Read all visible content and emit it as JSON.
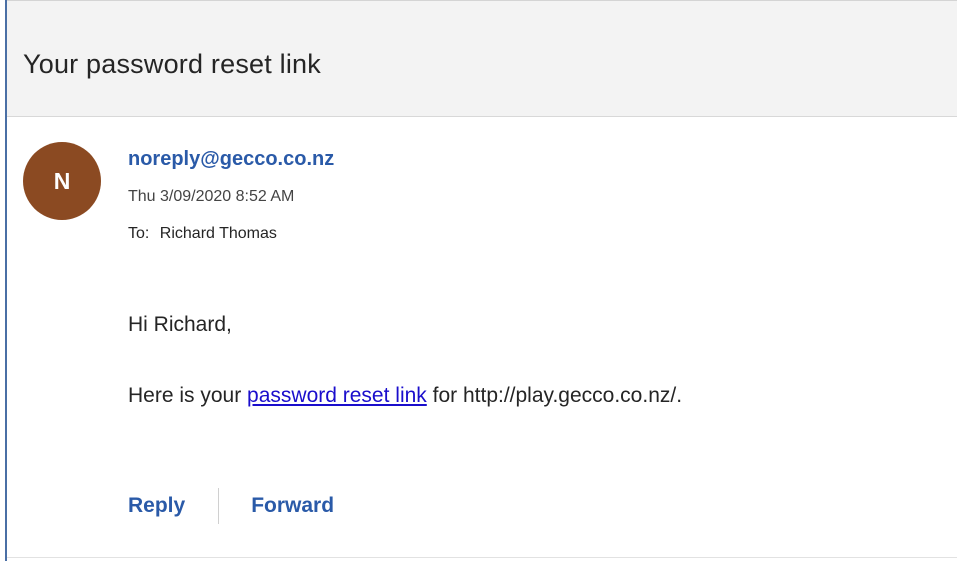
{
  "email": {
    "subject": "Your password reset link",
    "sender": {
      "initial": "N",
      "address": "noreply@gecco.co.nz",
      "avatar_color": "#8b4a22"
    },
    "datetime": "Thu 3/09/2020 8:52 AM",
    "to": {
      "label": "To:",
      "name": "Richard Thomas"
    },
    "body": {
      "greeting": "Hi Richard,",
      "line_before_link": "Here is your ",
      "link_text": "password reset link",
      "line_after_link": " for http://play.gecco.co.nz/."
    },
    "actions": {
      "reply_label": "Reply",
      "forward_label": "Forward"
    }
  },
  "colors": {
    "accent": "#2a5aa8",
    "link": "#1a0dcc",
    "subject_bar": "#f3f3f3"
  }
}
